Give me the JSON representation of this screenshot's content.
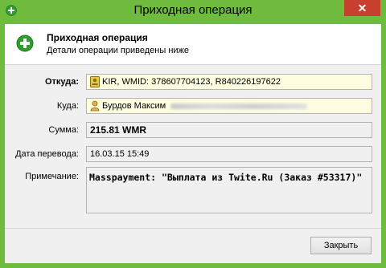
{
  "window": {
    "title": "Приходная операция",
    "close_glyph": "✕"
  },
  "header": {
    "title": "Приходная операция",
    "subtitle": "Детали операции приведены ниже"
  },
  "fields": {
    "from": {
      "label": "Откуда:",
      "value": "KIR, WMID: 378607704123, R840226197622"
    },
    "to": {
      "label": "Куда:",
      "value": "Бурдов Максим"
    },
    "amount": {
      "label": "Сумма:",
      "value": "215.81 WMR"
    },
    "date": {
      "label": "Дата перевода:",
      "value": "16.03.15 15:49"
    },
    "note": {
      "label": "Примечание:",
      "value": "Masspayment: \"Выплата из Twite.Ru (Заказ #53317)\""
    }
  },
  "buttons": {
    "close_label": "Закрыть"
  },
  "colors": {
    "titlebar": "#6fbb3e",
    "close": "#c7402d",
    "accent_green": "#2e9e2e"
  },
  "icons": {
    "app": "plus-circle-icon",
    "header": "plus-circle-icon",
    "from": "webmoney-passport-icon",
    "to": "user-icon"
  }
}
